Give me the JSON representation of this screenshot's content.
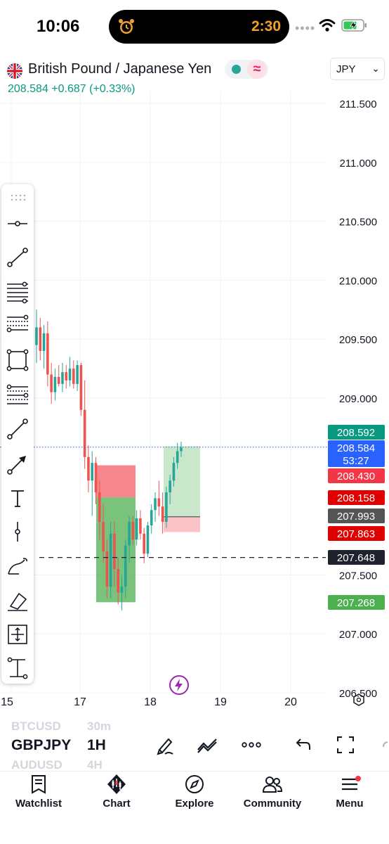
{
  "status_bar": {
    "time": "10:06",
    "timer": "2:30"
  },
  "header": {
    "pair_name": "British Pound / Japanese Yen",
    "last_price": "208.584",
    "change": "+0.687",
    "change_percent": "(+0.33%)",
    "currency": "JPY"
  },
  "chart_data": {
    "type": "candlestick",
    "y_axis": {
      "min": 206.4,
      "max": 211.7,
      "ticks": [
        "211.500",
        "211.000",
        "210.500",
        "210.000",
        "209.500",
        "209.000",
        "207.500",
        "207.000",
        "206.500"
      ]
    },
    "x_axis": {
      "ticks": [
        "15",
        "17",
        "18",
        "19",
        "20"
      ]
    },
    "price_labels": [
      {
        "value": 208.592,
        "text": "208.592",
        "color": "#089981"
      },
      {
        "value": 208.584,
        "text": "208.584",
        "sub": "53:27",
        "color": "#2962ff"
      },
      {
        "value": 208.43,
        "text": "208.430",
        "color": "#f23645"
      },
      {
        "value": 208.158,
        "text": "208.158",
        "color": "#e00000"
      },
      {
        "value": 207.993,
        "text": "207.993",
        "color": "#555555"
      },
      {
        "value": 207.863,
        "text": "207.863",
        "color": "#e00000"
      },
      {
        "value": 207.648,
        "text": "207.648",
        "color": "#1e222d"
      },
      {
        "value": 207.268,
        "text": "207.268",
        "color": "#4caf50"
      }
    ],
    "dashed_level": 207.648,
    "current_price": 208.584,
    "candles": [
      [
        209.45,
        209.75,
        209.3,
        209.6
      ],
      [
        209.6,
        209.68,
        209.32,
        209.4
      ],
      [
        209.4,
        209.62,
        209.25,
        209.55
      ],
      [
        209.55,
        209.65,
        209.1,
        209.2
      ],
      [
        209.2,
        209.3,
        208.95,
        209.05
      ],
      [
        209.05,
        209.25,
        208.98,
        209.18
      ],
      [
        209.18,
        209.28,
        209.1,
        209.12
      ],
      [
        209.12,
        209.3,
        209.05,
        209.22
      ],
      [
        209.22,
        209.28,
        209.08,
        209.15
      ],
      [
        209.15,
        209.35,
        209.1,
        209.25
      ],
      [
        209.25,
        209.32,
        209.08,
        209.12
      ],
      [
        209.12,
        209.32,
        209.06,
        209.28
      ],
      [
        209.28,
        209.3,
        208.85,
        208.9
      ],
      [
        208.9,
        209.15,
        208.4,
        208.5
      ],
      [
        208.5,
        208.6,
        208.2,
        208.3
      ],
      [
        208.3,
        208.55,
        208.0,
        208.45
      ],
      [
        208.45,
        208.5,
        208.1,
        208.2
      ],
      [
        208.2,
        208.3,
        207.8,
        207.95
      ],
      [
        207.95,
        208.1,
        207.6,
        207.7
      ],
      [
        207.7,
        207.8,
        207.3,
        207.4
      ],
      [
        207.4,
        207.95,
        207.3,
        207.85
      ],
      [
        207.85,
        207.95,
        207.4,
        207.55
      ],
      [
        207.55,
        207.65,
        207.25,
        207.35
      ],
      [
        207.35,
        207.5,
        207.2,
        207.4
      ],
      [
        207.4,
        207.8,
        207.3,
        207.75
      ],
      [
        207.75,
        208.0,
        207.6,
        207.95
      ],
      [
        207.95,
        208.0,
        207.75,
        207.8
      ],
      [
        207.8,
        208.05,
        207.75,
        207.98
      ],
      [
        207.98,
        208.05,
        207.8,
        207.85
      ],
      [
        207.85,
        207.9,
        207.6,
        207.68
      ],
      [
        207.68,
        207.95,
        207.65,
        207.92
      ],
      [
        207.92,
        208.1,
        207.85,
        208.05
      ],
      [
        208.05,
        208.2,
        207.95,
        208.15
      ],
      [
        208.15,
        208.3,
        208.0,
        208.08
      ],
      [
        208.08,
        208.2,
        207.85,
        207.95
      ],
      [
        207.95,
        208.25,
        207.9,
        208.2
      ],
      [
        208.2,
        208.35,
        208.1,
        208.3
      ],
      [
        208.3,
        208.5,
        208.25,
        208.45
      ],
      [
        208.45,
        208.62,
        208.4,
        208.55
      ],
      [
        208.55,
        208.63,
        208.5,
        208.58
      ]
    ],
    "positions": [
      {
        "type": "short",
        "entry": 208.158,
        "stop": 208.43,
        "target": 207.268
      },
      {
        "type": "long",
        "entry": 207.993,
        "stop": 207.863,
        "target": 208.592
      }
    ]
  },
  "bottom_bar": {
    "symbol": "GBPJPY",
    "interval": "1H",
    "ghost_above": "BTCUSD",
    "ghost_above_interval": "30m",
    "ghost_below": "AUDUSD",
    "ghost_below_interval": "4H"
  },
  "tabs": [
    {
      "label": "Watchlist",
      "icon": "book-icon"
    },
    {
      "label": "Chart",
      "icon": "candles-icon"
    },
    {
      "label": "Explore",
      "icon": "compass-icon"
    },
    {
      "label": "Community",
      "icon": "people-icon"
    },
    {
      "label": "Menu",
      "icon": "hamburger-icon"
    }
  ],
  "colors": {
    "up": "#26a69a",
    "down": "#ef5350",
    "profit_zone": "#4caf50",
    "loss_zone": "#f23645"
  }
}
